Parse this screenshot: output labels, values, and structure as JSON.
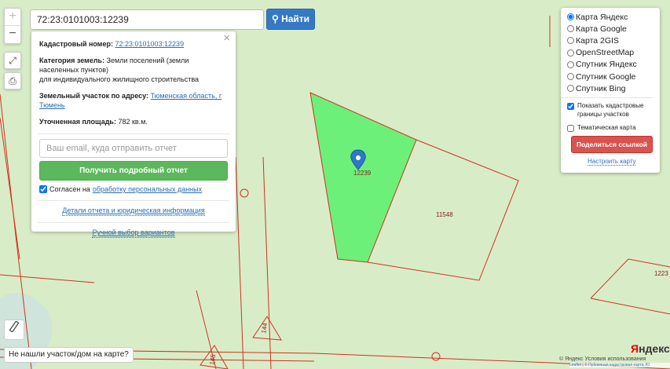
{
  "search": {
    "value": "72:23:0101003:12239",
    "button_label": "Найти"
  },
  "info": {
    "cad_label": "Кадастровый номер:",
    "cad_value": "72:23:0101003:12239",
    "cat_label": "Категория земель:",
    "cat_value": "Земли поселений (земли населенных пунктов)",
    "cat_value2": "для индивидуального жилищного строительства",
    "addr_label": "Земельный участок по адресу:",
    "addr_value": "Тюменская область, г Тюмень",
    "area_label": "Уточненная площадь:",
    "area_value": "782 кв.м.",
    "email_placeholder": "Ваш email, куда отправить отчет",
    "report_button": "Получить подробный отчет",
    "agree_text": "Согласен на",
    "agree_link": "обработку персональных данных",
    "details_link": "Детали отчета и юридическая информация",
    "manual_link": "Ручной выбор вариантов"
  },
  "layers": {
    "options": [
      "Карта Яндекс",
      "Карта Google",
      "Карта 2GIS",
      "OpenStreetMap",
      "Спутник Яндекс",
      "Спутник Google",
      "Спутник Bing"
    ],
    "selected": "Карта Яндекс",
    "cadastral_toggle": "Показать кадастровые границы участков",
    "thematic_toggle": "Тематическая карта",
    "share_button": "Поделиться ссылкой",
    "setup_link": "Настроить карту"
  },
  "map": {
    "parcel_labels": [
      "12239",
      "11548",
      "1223",
      "144",
      "145"
    ],
    "colors": {
      "background": "#d9ecc8",
      "parcel_fill": "#6df07a",
      "boundary": "#cc3322"
    }
  },
  "bottom": {
    "not_found": "Не нашли участок/дом на карте?",
    "logo": "Яндекс",
    "attribution": "© Яндекс Условия использования",
    "attribution2_a": "Leaflet",
    "attribution2_b": "© Публичная кадастровая карта, Ю"
  },
  "icons": [
    "fullscreen-icon",
    "print-icon",
    "ruler-icon",
    "map-pin-icon",
    "search-icon",
    "close-icon"
  ]
}
